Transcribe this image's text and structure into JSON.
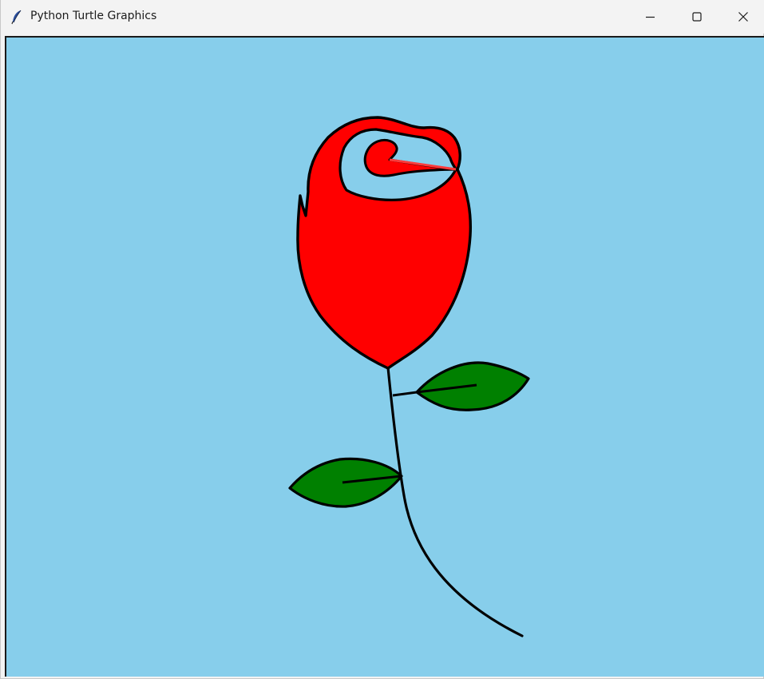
{
  "window": {
    "title": "Python Turtle Graphics",
    "app_icon": "feather-icon",
    "controls": {
      "minimize": "minimize-icon",
      "maximize": "maximize-icon",
      "close": "close-icon"
    }
  },
  "canvas": {
    "background_color": "#87ceeb",
    "drawing": {
      "subject": "rose",
      "petal_color": "#ff0000",
      "leaf_color": "#008000",
      "outline_color": "#000000"
    }
  }
}
